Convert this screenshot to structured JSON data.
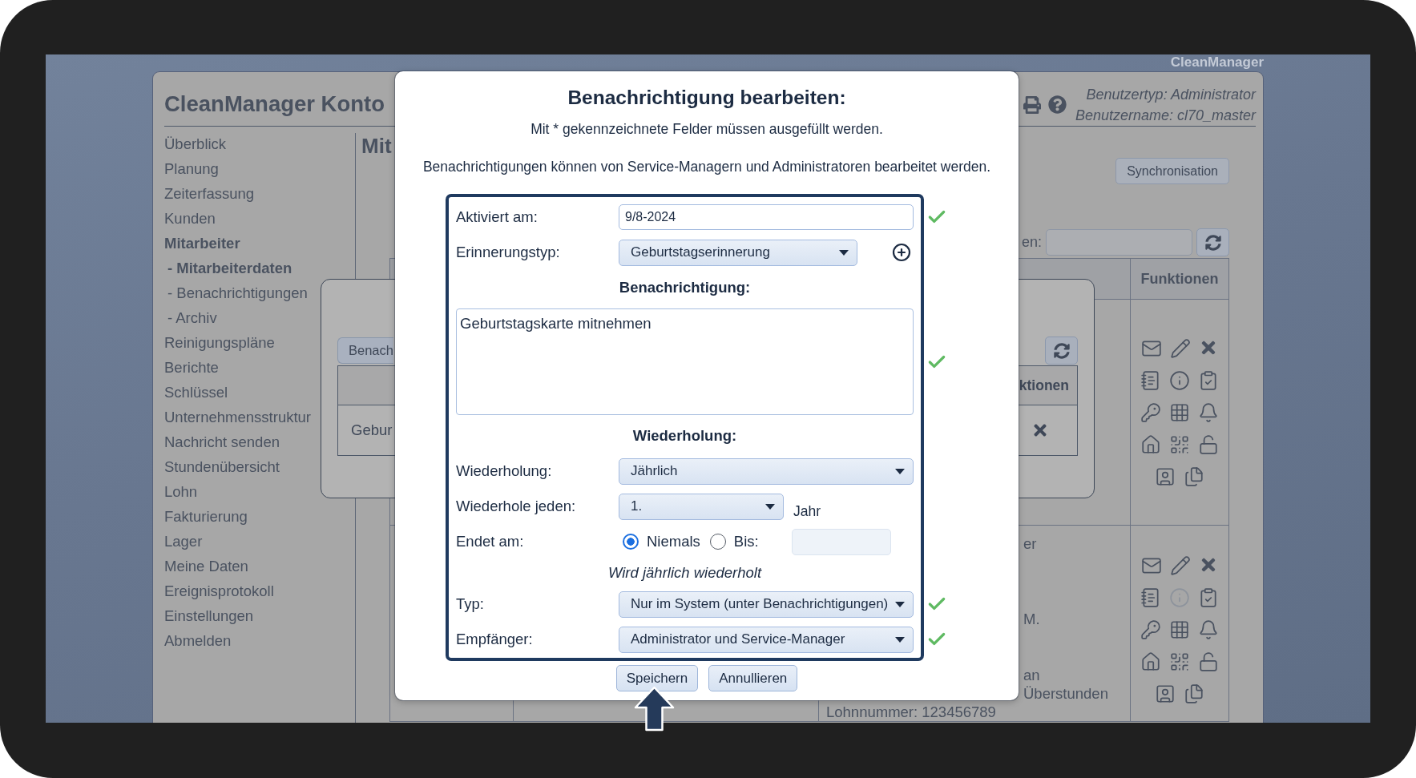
{
  "brand": "CleanManager",
  "header": {
    "title": "CleanManager Konto",
    "user_type": "Benutzertyp: Administrator",
    "user_name": "Benutzername: cl70_master"
  },
  "sidebar": {
    "items": [
      {
        "label": "Überblick",
        "selected": false
      },
      {
        "label": "Planung",
        "selected": false
      },
      {
        "label": "Zeiterfassung",
        "selected": false
      },
      {
        "label": "Kunden",
        "selected": false
      },
      {
        "label": "Mitarbeiter",
        "selected": true,
        "children": [
          {
            "label": "- Mitarbeiterdaten",
            "selected": true
          },
          {
            "label": "- Benachrichtigungen",
            "selected": false
          },
          {
            "label": "- Archiv",
            "selected": false
          }
        ]
      },
      {
        "label": "Reinigungspläne",
        "selected": false
      },
      {
        "label": "Berichte",
        "selected": false
      },
      {
        "label": "Schlüssel",
        "selected": false
      },
      {
        "label": "Unternehmensstruktur",
        "selected": false
      },
      {
        "label": "Nachricht senden",
        "selected": false
      },
      {
        "label": "Stundenübersicht",
        "selected": false
      },
      {
        "label": "Lohn",
        "selected": false
      },
      {
        "label": "Fakturierung",
        "selected": false
      },
      {
        "label": "Lager",
        "selected": false
      },
      {
        "label": "Meine Daten",
        "selected": false
      },
      {
        "label": "Ereignisprotokoll",
        "selected": false
      },
      {
        "label": "Einstellungen",
        "selected": false
      },
      {
        "label": "Abmelden",
        "selected": false
      }
    ]
  },
  "content": {
    "heading": "Mit",
    "sync_button": "Synchronisation",
    "search_label": "en:",
    "table": {
      "function_column": "Funktionen",
      "rows": [
        {
          "info_disabled": false
        },
        {
          "column_3": {
            "fragments": [
              "er",
              "M.",
              "an",
              "Überstunden"
            ],
            "text": "Lohnnummer: 123456789"
          },
          "info_disabled": true
        }
      ]
    }
  },
  "background_dialog": {
    "button": "Benach",
    "column": "ktionen",
    "cell": "Gebur"
  },
  "dialog": {
    "title": "Benachrichtigung bearbeiten:",
    "required_note": "Mit * gekennzeichnete Felder müssen ausgefüllt werden.",
    "info": "Benachrichtigungen können von Service-Managern und Administratoren bearbeitet werden.",
    "fields": [
      {
        "kind": "text",
        "label": "Aktiviert am:",
        "value": "9/8-2024",
        "valid": true
      },
      {
        "kind": "select",
        "label": "Erinnerungstyp:",
        "value": "Geburtstagserinnerung",
        "valid": false,
        "addable": true
      },
      {
        "kind": "section",
        "label": "Benachrichtigung:"
      },
      {
        "kind": "textarea",
        "value": "Geburtstagskarte mitnehmen",
        "valid": true
      },
      {
        "kind": "section",
        "label": "Wiederholung:"
      },
      {
        "kind": "select",
        "label": "Wiederholung:",
        "value": "Jährlich",
        "valid": false
      },
      {
        "kind": "select",
        "label": "Wiederhole jeden:",
        "value": "1.",
        "unit": "Jahr",
        "valid": false
      },
      {
        "kind": "radio",
        "label": "Endet am:",
        "options": [
          {
            "label": "Niemals",
            "selected": true
          },
          {
            "label": "Bis:",
            "selected": false
          }
        ],
        "date_disabled": true,
        "valid": false
      },
      {
        "kind": "note",
        "label": "Wird jährlich wiederholt"
      },
      {
        "kind": "select",
        "label": "Typ:",
        "value": "Nur im System (unter Benachrichtigungen)",
        "valid": true
      },
      {
        "kind": "select",
        "label": "Empfänger:",
        "value": "Administrator und Service-Manager",
        "valid": true
      }
    ],
    "buttons": [
      "Speichern",
      "Annullieren"
    ]
  }
}
